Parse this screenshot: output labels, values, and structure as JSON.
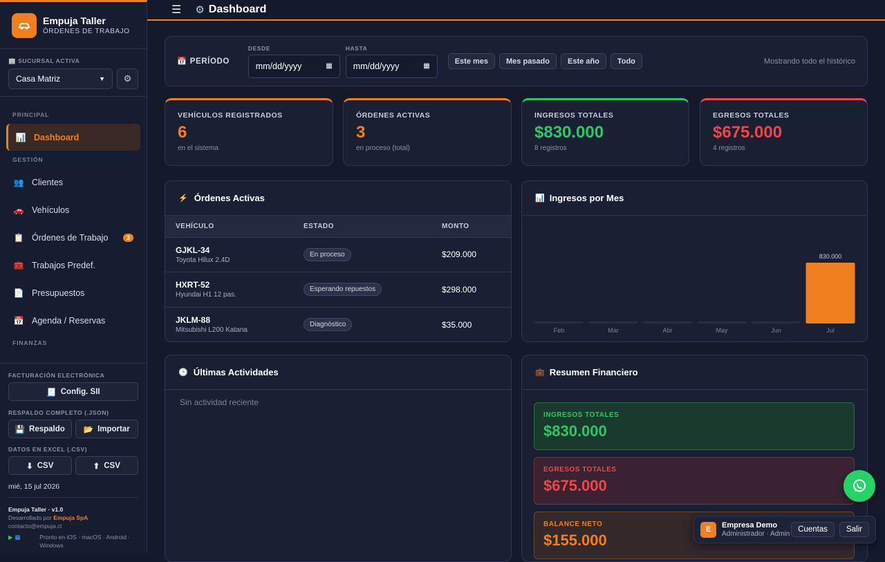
{
  "app": {
    "name": "Empuja Taller",
    "subtitle": "ÓRDENES DE TRABAJO",
    "logo_icon": "car-wrench-icon",
    "accent": "#f07f1e"
  },
  "branch": {
    "label": "🏢 SUCURSAL ACTIVA",
    "value": "Casa Matriz",
    "settings_icon": "gear-icon"
  },
  "nav": {
    "sections": [
      "PRINCIPAL",
      "GESTIÓN",
      "FINANZAS"
    ],
    "items": [
      {
        "icon": "📊",
        "label": "Dashboard"
      },
      {
        "icon": "👥",
        "label": "Clientes"
      },
      {
        "icon": "🚗",
        "label": "Vehículos"
      },
      {
        "icon": "📋",
        "label": "Órdenes de Trabajo",
        "badge": "3"
      },
      {
        "icon": "🧰",
        "label": "Trabajos Predef."
      },
      {
        "icon": "📄",
        "label": "Presupuestos"
      },
      {
        "icon": "📅",
        "label": "Agenda / Reservas"
      }
    ]
  },
  "sidebar_bottom": {
    "billing_label": "FACTURACIÓN ELECTRÓNICA",
    "sii_button": "Config. SII",
    "backup_label": "RESPALDO COMPLETO (.JSON)",
    "backup_button": "Respaldo",
    "import_button": "Importar",
    "excel_label": "DATOS EN EXCEL (.CSV)",
    "csv_down": "CSV",
    "csv_up": "CSV",
    "date": "mié, 15 jul 2026",
    "version": "Empuja Taller · v1.0",
    "dev_prefix": "Desarrollado por",
    "dev_name": "Empuja SpA",
    "contact": "contacto@empuja.cl",
    "platforms": "Pronto en iOS · macOS · Android · Windows"
  },
  "topbar": {
    "title": "Dashboard",
    "title_icon": "gear-icon"
  },
  "period": {
    "label": "PERÍODO",
    "from_label": "DESDE",
    "to_label": "HASTA",
    "from_placeholder": "mm/dd/yyyy",
    "to_placeholder": "mm/dd/yyyy",
    "quick": [
      "Este mes",
      "Mes pasado",
      "Este año",
      "Todo"
    ],
    "status": "Mostrando todo el histórico"
  },
  "kpis": [
    {
      "label": "VEHÍCULOS REGISTRADOS",
      "value": "6",
      "sub": "en el sistema",
      "color": "#f07f1e"
    },
    {
      "label": "ÓRDENES ACTIVAS",
      "value": "3",
      "sub": "en proceso (total)",
      "color": "#f07f1e"
    },
    {
      "label": "INGRESOS TOTALES",
      "value": "$830.000",
      "sub": "8 registros",
      "color": "#2fc766"
    },
    {
      "label": "EGRESOS TOTALES",
      "value": "$675.000",
      "sub": "4 registros",
      "color": "#ef4449"
    }
  ],
  "orders": {
    "title": "Órdenes Activas",
    "columns": [
      "VEHÍCULO",
      "ESTADO",
      "MONTO"
    ],
    "rows": [
      {
        "plate": "GJKL-34",
        "model": "Toyota Hilux 2.4D",
        "state": "En proceso",
        "amount": "$209.000"
      },
      {
        "plate": "HXRT-52",
        "model": "Hyundai H1 12 pas.",
        "state": "Esperando repuestos",
        "amount": "$298.000"
      },
      {
        "plate": "JKLM-88",
        "model": "Mitsubishi L200 Katana",
        "state": "Diagnóstico",
        "amount": "$35.000"
      }
    ]
  },
  "chart_title": "Ingresos por Mes",
  "chart_data": {
    "type": "bar",
    "categories": [
      "Feb",
      "Mar",
      "Abr",
      "May",
      "Jun",
      "Jul"
    ],
    "values": [
      0,
      0,
      0,
      0,
      0,
      830000
    ],
    "value_labels": [
      "",
      "",
      "",
      "",
      "",
      "830.000"
    ],
    "title": "",
    "ylim": [
      0,
      830000
    ],
    "grid": false,
    "color": "#f07f1e"
  },
  "activities": {
    "title": "Últimas Actividades",
    "empty": "Sin actividad reciente"
  },
  "finance": {
    "title": "Resumen Financiero",
    "items": [
      {
        "label": "INGRESOS TOTALES",
        "value": "$830.000"
      },
      {
        "label": "EGRESOS TOTALES",
        "value": "$675.000"
      },
      {
        "label": "BALANCE NETO",
        "value": "$155.000"
      }
    ]
  },
  "account": {
    "initial": "E",
    "name": "Empresa Demo",
    "role": "Administrador · Admin",
    "accounts_button": "Cuentas",
    "logout_button": "Salir"
  }
}
